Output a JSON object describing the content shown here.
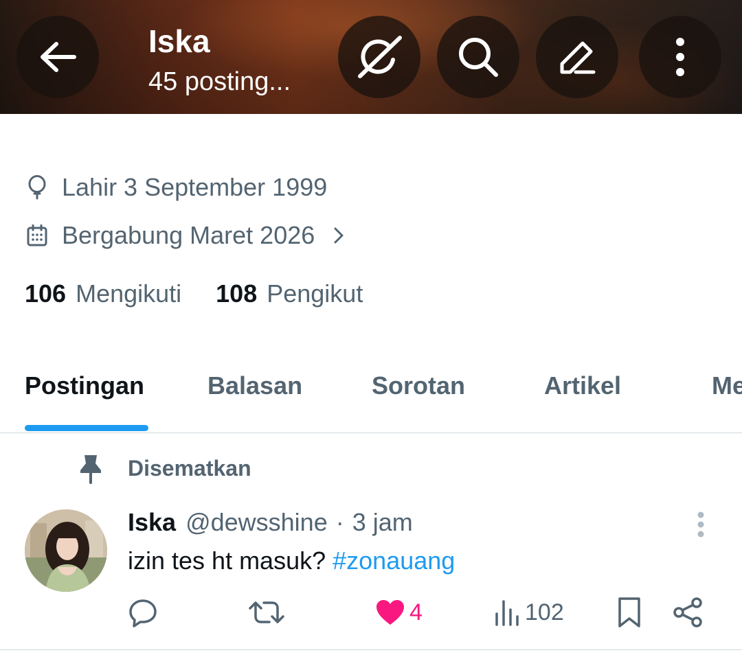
{
  "header": {
    "name": "Iska",
    "post_count": "45 posting...",
    "icons": [
      "back-arrow-icon",
      "grok-icon",
      "search-icon",
      "edit-icon",
      "more-vertical-icon"
    ]
  },
  "profile": {
    "birth": "Lahir 3 September 1999",
    "joined": "Bergabung Maret 2026",
    "following_count": "106",
    "following_label": "Mengikuti",
    "followers_count": "108",
    "followers_label": "Pengikut"
  },
  "tabs": [
    {
      "label": "Postingan",
      "active": true
    },
    {
      "label": "Balasan",
      "active": false
    },
    {
      "label": "Sorotan",
      "active": false
    },
    {
      "label": "Artikel",
      "active": false
    },
    {
      "label": "Me",
      "active": false
    }
  ],
  "pinned_post": {
    "pinned_label": "Disematkan",
    "author_name": "Iska",
    "handle": "@dewsshine",
    "separator": "·",
    "time": "3 jam",
    "text": "izin tes ht masuk?",
    "hashtag": "#zonauang",
    "like_count": "4",
    "view_count": "102",
    "liked": true
  },
  "colors": {
    "accent": "#1d9bf0",
    "text_primary": "#0f1419",
    "text_secondary": "#536471",
    "like": "#f91880",
    "divider": "#cfd9de"
  }
}
